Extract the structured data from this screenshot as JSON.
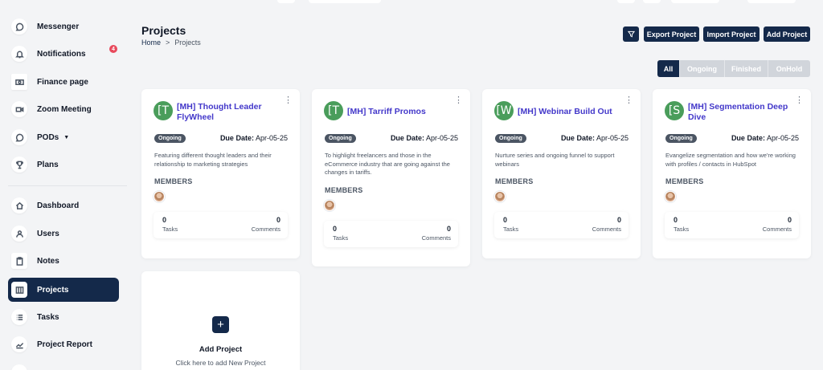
{
  "sidebar": {
    "items": [
      {
        "label": "Messenger",
        "icon": "chat-icon"
      },
      {
        "label": "Notifications",
        "icon": "bell-icon",
        "badge": "4"
      },
      {
        "label": "Finance page",
        "icon": "money-icon"
      },
      {
        "label": "Zoom Meeting",
        "icon": "video-icon"
      },
      {
        "label": "PODs",
        "icon": "chat-icon",
        "caret": "▼"
      },
      {
        "label": "Plans",
        "icon": "trophy-icon"
      },
      {
        "label": "Dashboard",
        "icon": "home-icon"
      },
      {
        "label": "Users",
        "icon": "user-icon"
      },
      {
        "label": "Notes",
        "icon": "clipboard-icon"
      },
      {
        "label": "Projects",
        "icon": "projects-icon",
        "active": true
      },
      {
        "label": "Tasks",
        "icon": "list-icon"
      },
      {
        "label": "Project Report",
        "icon": "chart-icon"
      }
    ]
  },
  "header": {
    "title": "Projects",
    "breadcrumb": {
      "home": "Home",
      "separator": ">",
      "current": "Projects"
    },
    "filter_icon": "filter-icon",
    "export_label": "Export Project",
    "import_label": "Import Project",
    "add_label": "Add Project"
  },
  "filters": [
    "All",
    "Ongoing",
    "Finished",
    "OnHold"
  ],
  "members_label": "MEMBERS",
  "tasks_label": "Tasks",
  "comments_label": "Comments",
  "due_prefix": "Due Date:",
  "projects": [
    {
      "letter": "[T",
      "title": "[MH] Thought Leader FlyWheel",
      "status": "Ongoing",
      "due": "Apr-05-25",
      "description": "Featuring different thought leaders and their relationship to marketing strategies",
      "tasks": "0",
      "comments": "0"
    },
    {
      "letter": "[T",
      "title": "[MH] Tarriff Promos",
      "status": "Ongoing",
      "due": "Apr-05-25",
      "description": "To highlight freelancers and those in the eCommerce industry that are going against the changes in tariffs.",
      "tasks": "0",
      "comments": "0"
    },
    {
      "letter": "[W",
      "title": "[MH] Webinar Build Out",
      "status": "Ongoing",
      "due": "Apr-05-25",
      "description": "Nurture series and ongoing funnel to support webinars",
      "tasks": "0",
      "comments": "0"
    },
    {
      "letter": "[S",
      "title": "[MH] Segmentation Deep Dive",
      "status": "Ongoing",
      "due": "Apr-05-25",
      "description": "Evangelize segmentation and how we're working with profiles / contacts in HubSpot",
      "tasks": "0",
      "comments": "0"
    }
  ],
  "add_card": {
    "plus": "+",
    "title": "Add Project",
    "subtitle": "Click here to add New Project"
  },
  "colors": {
    "primary": "#14294a",
    "accent_title": "#4338ca",
    "avatar_green": "#4a9d5b",
    "badge_red": "#e8495c"
  }
}
